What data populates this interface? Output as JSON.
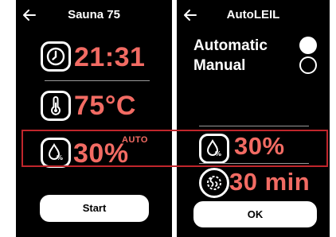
{
  "colors": {
    "accent": "#f26b63",
    "screen_bg": "#000000",
    "highlight": "#c0262c"
  },
  "left_screen": {
    "title": "Sauna 75",
    "back_icon": "arrow-left-icon",
    "time": {
      "icon": "clock-icon",
      "value": "21:31"
    },
    "temperature": {
      "icon": "thermometer-icon",
      "value": "75°C"
    },
    "humidity": {
      "icon": "humidity-drop-icon",
      "value": "30%",
      "badge": "AUTO"
    },
    "start_label": "Start"
  },
  "right_screen": {
    "title": "AutoLEIL",
    "back_icon": "arrow-left-icon",
    "options": [
      {
        "label": "Automatic",
        "selected": true
      },
      {
        "label": "Manual",
        "selected": false
      }
    ],
    "humidity": {
      "icon": "humidity-drop-icon",
      "value": "30%"
    },
    "duration": {
      "icon": "steam-timer-icon",
      "value": "30 min"
    },
    "ok_label": "OK"
  }
}
